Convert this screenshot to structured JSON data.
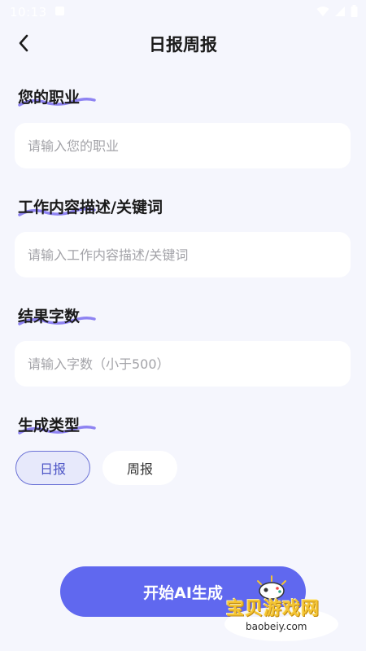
{
  "status_bar": {
    "time": "10:13"
  },
  "header": {
    "title": "日报周报"
  },
  "fields": {
    "profession": {
      "label": "您的职业",
      "placeholder": "请输入您的职业"
    },
    "work": {
      "label": "工作内容描述/关键词",
      "placeholder": "请输入工作内容描述/关键词"
    },
    "word_count": {
      "label": "结果字数",
      "placeholder": "请输入字数（小于500）"
    }
  },
  "gen_type": {
    "label": "生成类型",
    "options": [
      "日报",
      "周报"
    ],
    "selected": "日报"
  },
  "generate_button": "开始AI生成",
  "watermark": {
    "text": "宝贝游戏网",
    "url": "baobeiy.com"
  },
  "colors": {
    "accent": "#6068ef",
    "background": "#f5f6fd",
    "underline": "#7b6ef0"
  }
}
